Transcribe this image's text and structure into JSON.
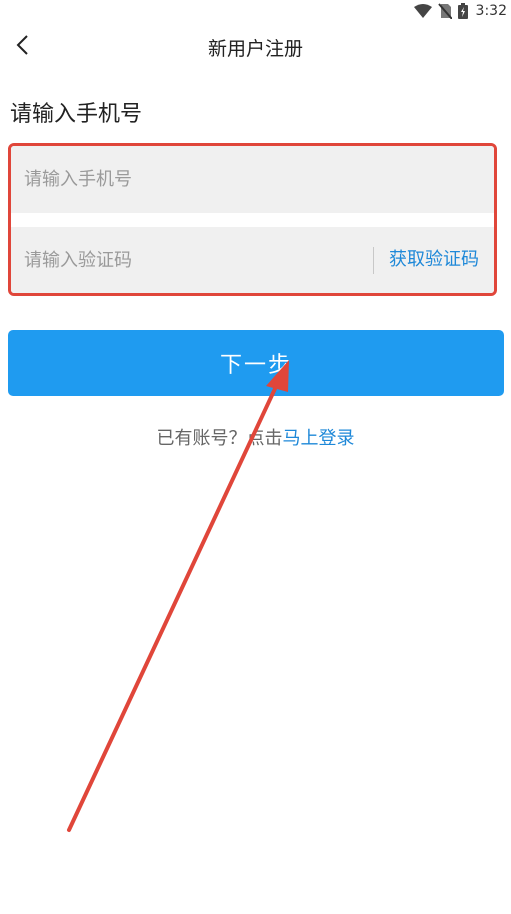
{
  "status_bar": {
    "time": "3:32"
  },
  "nav": {
    "title": "新用户注册"
  },
  "form": {
    "section_label": "请输入手机号",
    "phone_placeholder": "请输入手机号",
    "code_placeholder": "请输入验证码",
    "get_code_label": "获取验证码"
  },
  "next_button": {
    "label": "下一步"
  },
  "login_prompt": {
    "text": "已有账号？点击",
    "link": "马上登录"
  },
  "colors": {
    "accent": "#1f9bf0",
    "link": "#1e88d8",
    "highlight_border": "#e0463a",
    "field_bg": "#f0f0f0"
  },
  "icons": [
    "wifi-icon",
    "no-sim-icon",
    "battery-charging-icon",
    "back-chevron-icon"
  ]
}
